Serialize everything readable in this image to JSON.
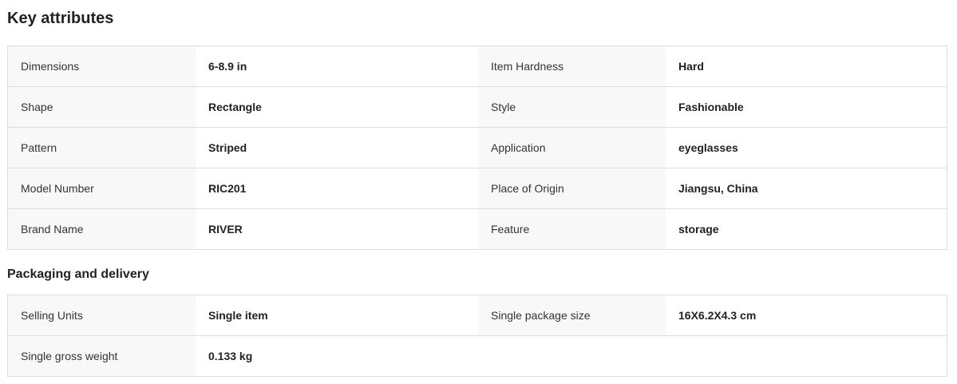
{
  "key_attributes": {
    "title": "Key attributes",
    "rows": [
      {
        "label_a": "Dimensions",
        "value_a": "6-8.9 in",
        "label_b": "Item Hardness",
        "value_b": "Hard"
      },
      {
        "label_a": "Shape",
        "value_a": "Rectangle",
        "label_b": "Style",
        "value_b": "Fashionable"
      },
      {
        "label_a": "Pattern",
        "value_a": "Striped",
        "label_b": "Application",
        "value_b": "eyeglasses"
      },
      {
        "label_a": "Model Number",
        "value_a": "RIC201",
        "label_b": "Place of Origin",
        "value_b": "Jiangsu, China"
      },
      {
        "label_a": "Brand Name",
        "value_a": "RIVER",
        "label_b": "Feature",
        "value_b": "storage"
      }
    ]
  },
  "packaging": {
    "title": "Packaging and delivery",
    "rows": [
      {
        "label_a": "Selling Units",
        "value_a": "Single item",
        "label_b": "Single package size",
        "value_b": "16X6.2X4.3 cm"
      },
      {
        "label_a": "Single gross weight",
        "value_a": "0.133 kg"
      }
    ]
  }
}
